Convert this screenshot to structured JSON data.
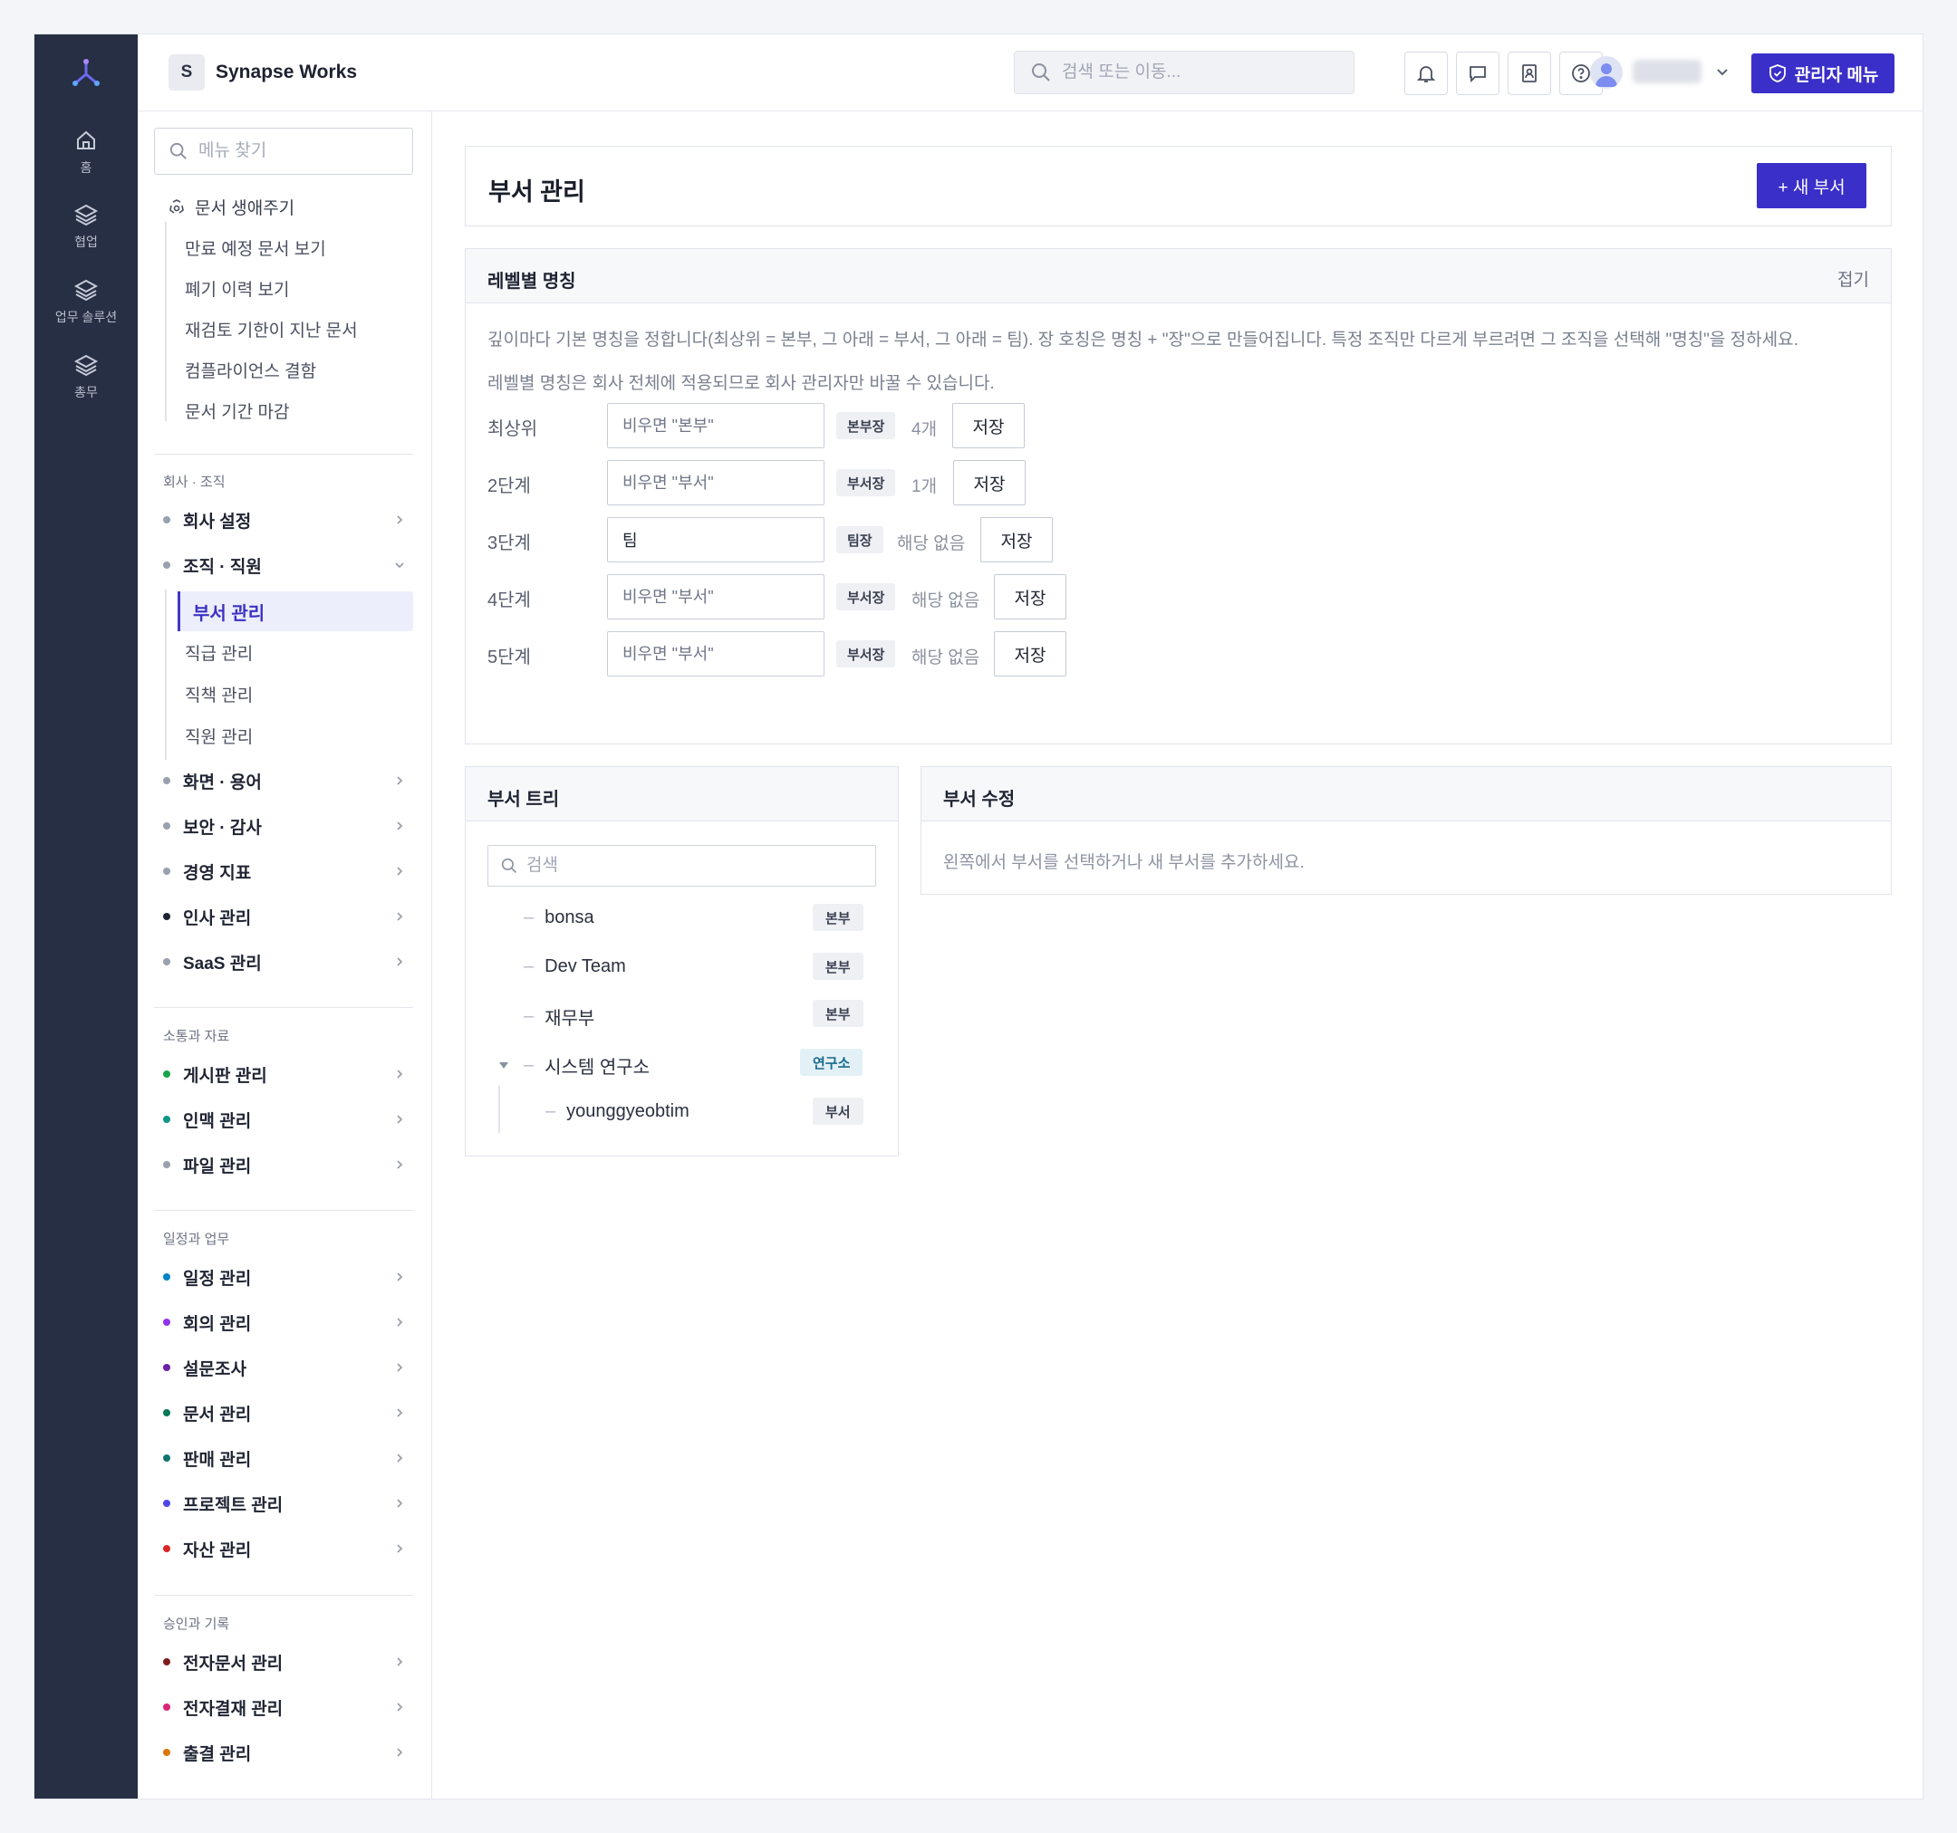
{
  "rail": {
    "items": [
      {
        "label": "홈",
        "icon": "home-icon"
      },
      {
        "label": "협업",
        "icon": "layers-icon"
      },
      {
        "label": "업무 솔루션",
        "icon": "layers-icon"
      },
      {
        "label": "총무",
        "icon": "layers-icon"
      }
    ]
  },
  "header": {
    "brand_initial": "S",
    "brand_name": "Synapse Works",
    "search_placeholder": "검색 또는 이동...",
    "admin_label": "관리자 메뉴"
  },
  "sidebar": {
    "search_placeholder": "메뉴 찾기",
    "lifecycle": {
      "title": "문서 생애주기",
      "items": [
        "만료 예정 문서 보기",
        "폐기 이력 보기",
        "재검토 기한이 지난 문서",
        "컴플라이언스 결함",
        "문서 기간 마감"
      ]
    },
    "section1": {
      "title": "회사 · 조직",
      "company": "회사 설정",
      "org": "조직 · 직원",
      "org_items": [
        "부서 관리",
        "직급 관리",
        "직책 관리",
        "직원 관리"
      ],
      "rest": [
        "화면 · 용어",
        "보안 · 감사",
        "경영 지표",
        "인사 관리",
        "SaaS 관리"
      ]
    },
    "section2": {
      "title": "소통과 자료",
      "items": [
        "게시판 관리",
        "인맥 관리",
        "파일 관리"
      ]
    },
    "section3": {
      "title": "일정과 업무",
      "items": [
        "일정 관리",
        "회의 관리",
        "설문조사",
        "문서 관리",
        "판매 관리",
        "프로젝트 관리",
        "자산 관리"
      ]
    },
    "section4": {
      "title": "승인과 기록",
      "items": [
        "전자문서 관리",
        "전자결재 관리",
        "출결 관리"
      ]
    }
  },
  "colors": {
    "accent": "#3b2fc9",
    "dots": [
      "#9aa0ad",
      "#9aa0ad",
      "#9aa0ad",
      "#9aa0ad",
      "#9aa0ad",
      "#1f2433",
      "#9aa0ad",
      "#16a34a",
      "#0d9488",
      "#9aa0ad",
      "#0284c7",
      "#9333ea",
      "#6b21a8",
      "#047857",
      "#0f766e",
      "#4f46e5",
      "#dc2626",
      "#7f1d1d",
      "#db2777",
      "#d97706"
    ]
  },
  "main": {
    "title": "부서 관리",
    "new_button": "+ 새 부서",
    "levels": {
      "title": "레벨별 명칭",
      "fold": "접기",
      "desc1": "깊이마다 기본 명칭을 정합니다(최상위 = 본부, 그 아래 = 부서, 그 아래 = 팀). 장 호칭은 명칭 + \"장\"으로 만들어집니다. 특정 조직만 다르게 부르려면 그 조직을 선택해 \"명칭\"을 정하세요.",
      "desc2": "레벨별 명칭은 회사 전체에 적용되므로 회사 관리자만 바꿀 수 있습니다.",
      "save_label": "저장",
      "rows": [
        {
          "label": "최상위",
          "placeholder": "비우면 \"본부\"",
          "value": "",
          "tag": "본부장",
          "count": "4개"
        },
        {
          "label": "2단계",
          "placeholder": "비우면 \"부서\"",
          "value": "",
          "tag": "부서장",
          "count": "1개"
        },
        {
          "label": "3단계",
          "placeholder": "",
          "value": "팀",
          "tag": "팀장",
          "count": "해당 없음"
        },
        {
          "label": "4단계",
          "placeholder": "비우면 \"부서\"",
          "value": "",
          "tag": "부서장",
          "count": "해당 없음"
        },
        {
          "label": "5단계",
          "placeholder": "비우면 \"부서\"",
          "value": "",
          "tag": "부서장",
          "count": "해당 없음"
        }
      ]
    },
    "tree": {
      "title": "부서 트리",
      "search_placeholder": "검색",
      "nodes": [
        {
          "name": "bonsa",
          "tag": "본부"
        },
        {
          "name": "Dev Team",
          "tag": "본부"
        },
        {
          "name": "재무부",
          "tag": "본부"
        },
        {
          "name": "시스템 연구소",
          "tag": "연구소"
        },
        {
          "name": "younggyeobtim",
          "tag": "부서"
        }
      ]
    },
    "edit": {
      "title": "부서 수정",
      "empty": "왼쪽에서 부서를 선택하거나 새 부서를 추가하세요."
    }
  }
}
